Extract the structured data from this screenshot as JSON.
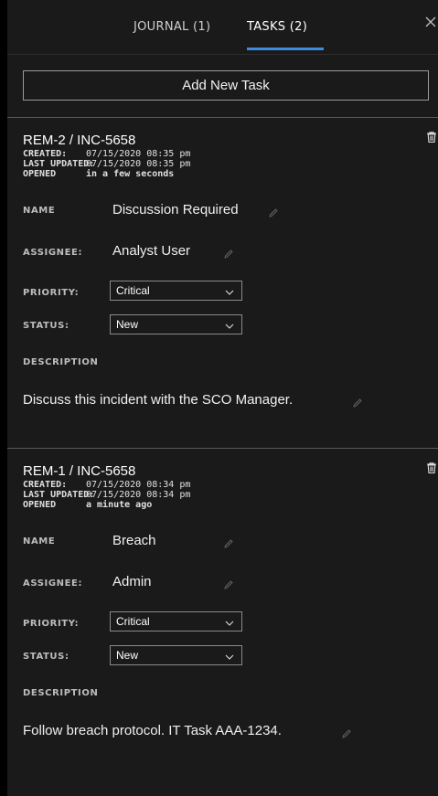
{
  "tabs": {
    "journal": "JOURNAL (1)",
    "tasks": "TASKS (2)",
    "active": "tasks"
  },
  "close_icon": "close-icon",
  "add_task_label": "Add New Task",
  "labels": {
    "created": "CREATED:",
    "last_updated": "LAST UPDATED:",
    "opened": "OPENED",
    "name": "NAME",
    "assignee": "ASSIGNEE:",
    "priority": "PRIORITY:",
    "status": "STATUS:",
    "description": "DESCRIPTION"
  },
  "tasks": [
    {
      "title": "REM-2 / INC-5658",
      "created": "07/15/2020 08:35 pm",
      "last_updated": "07/15/2020 08:35 pm",
      "opened": "in a few seconds",
      "name": "Discussion Required",
      "assignee": "Analyst User",
      "priority": "Critical",
      "status": "New",
      "description": "Discuss this incident with the SCO Manager."
    },
    {
      "title": "REM-1 / INC-5658",
      "created": "07/15/2020 08:34 pm",
      "last_updated": "07/15/2020 08:34 pm",
      "opened": "a minute ago",
      "name": "Breach",
      "assignee": "Admin",
      "priority": "Critical",
      "status": "New",
      "description": "Follow breach protocol. IT Task AAA-1234."
    }
  ],
  "colors": {
    "background": "#1a1a1a",
    "tab_underline": "#3c8dde",
    "text": "#f0f0f0"
  }
}
